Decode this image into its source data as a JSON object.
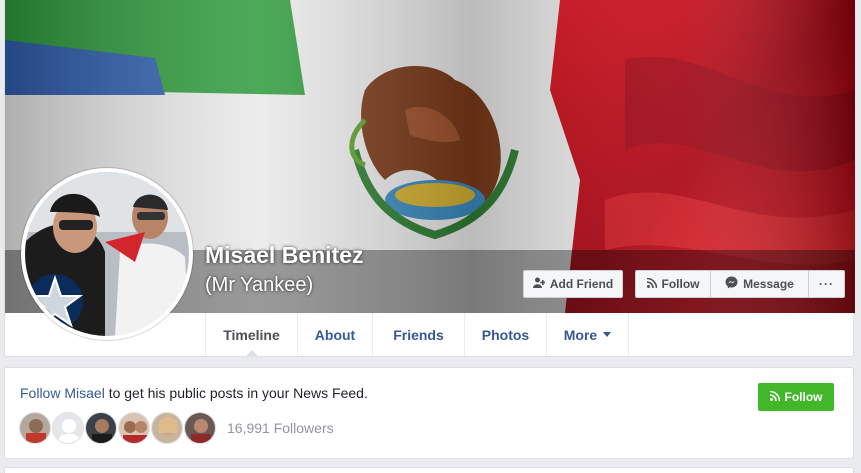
{
  "profile": {
    "name": "Misael Benitez",
    "nickname": "(Mr Yankee)"
  },
  "actions": {
    "add_friend": "Add Friend",
    "follow": "Follow",
    "message": "Message",
    "more": "···"
  },
  "nav": {
    "items": [
      {
        "label": "Timeline",
        "active": true
      },
      {
        "label": "About"
      },
      {
        "label": "Friends"
      },
      {
        "label": "Photos"
      },
      {
        "label": "More"
      }
    ]
  },
  "follow_card": {
    "link": "Follow Misael",
    "text": " to get his public posts in your News Feed.",
    "button": "Follow",
    "followers_count": "16,991 Followers"
  },
  "colors": {
    "link": "#365899",
    "green": "#42b72a",
    "flag_green": "#1f8a3a",
    "flag_red": "#c8102e"
  }
}
